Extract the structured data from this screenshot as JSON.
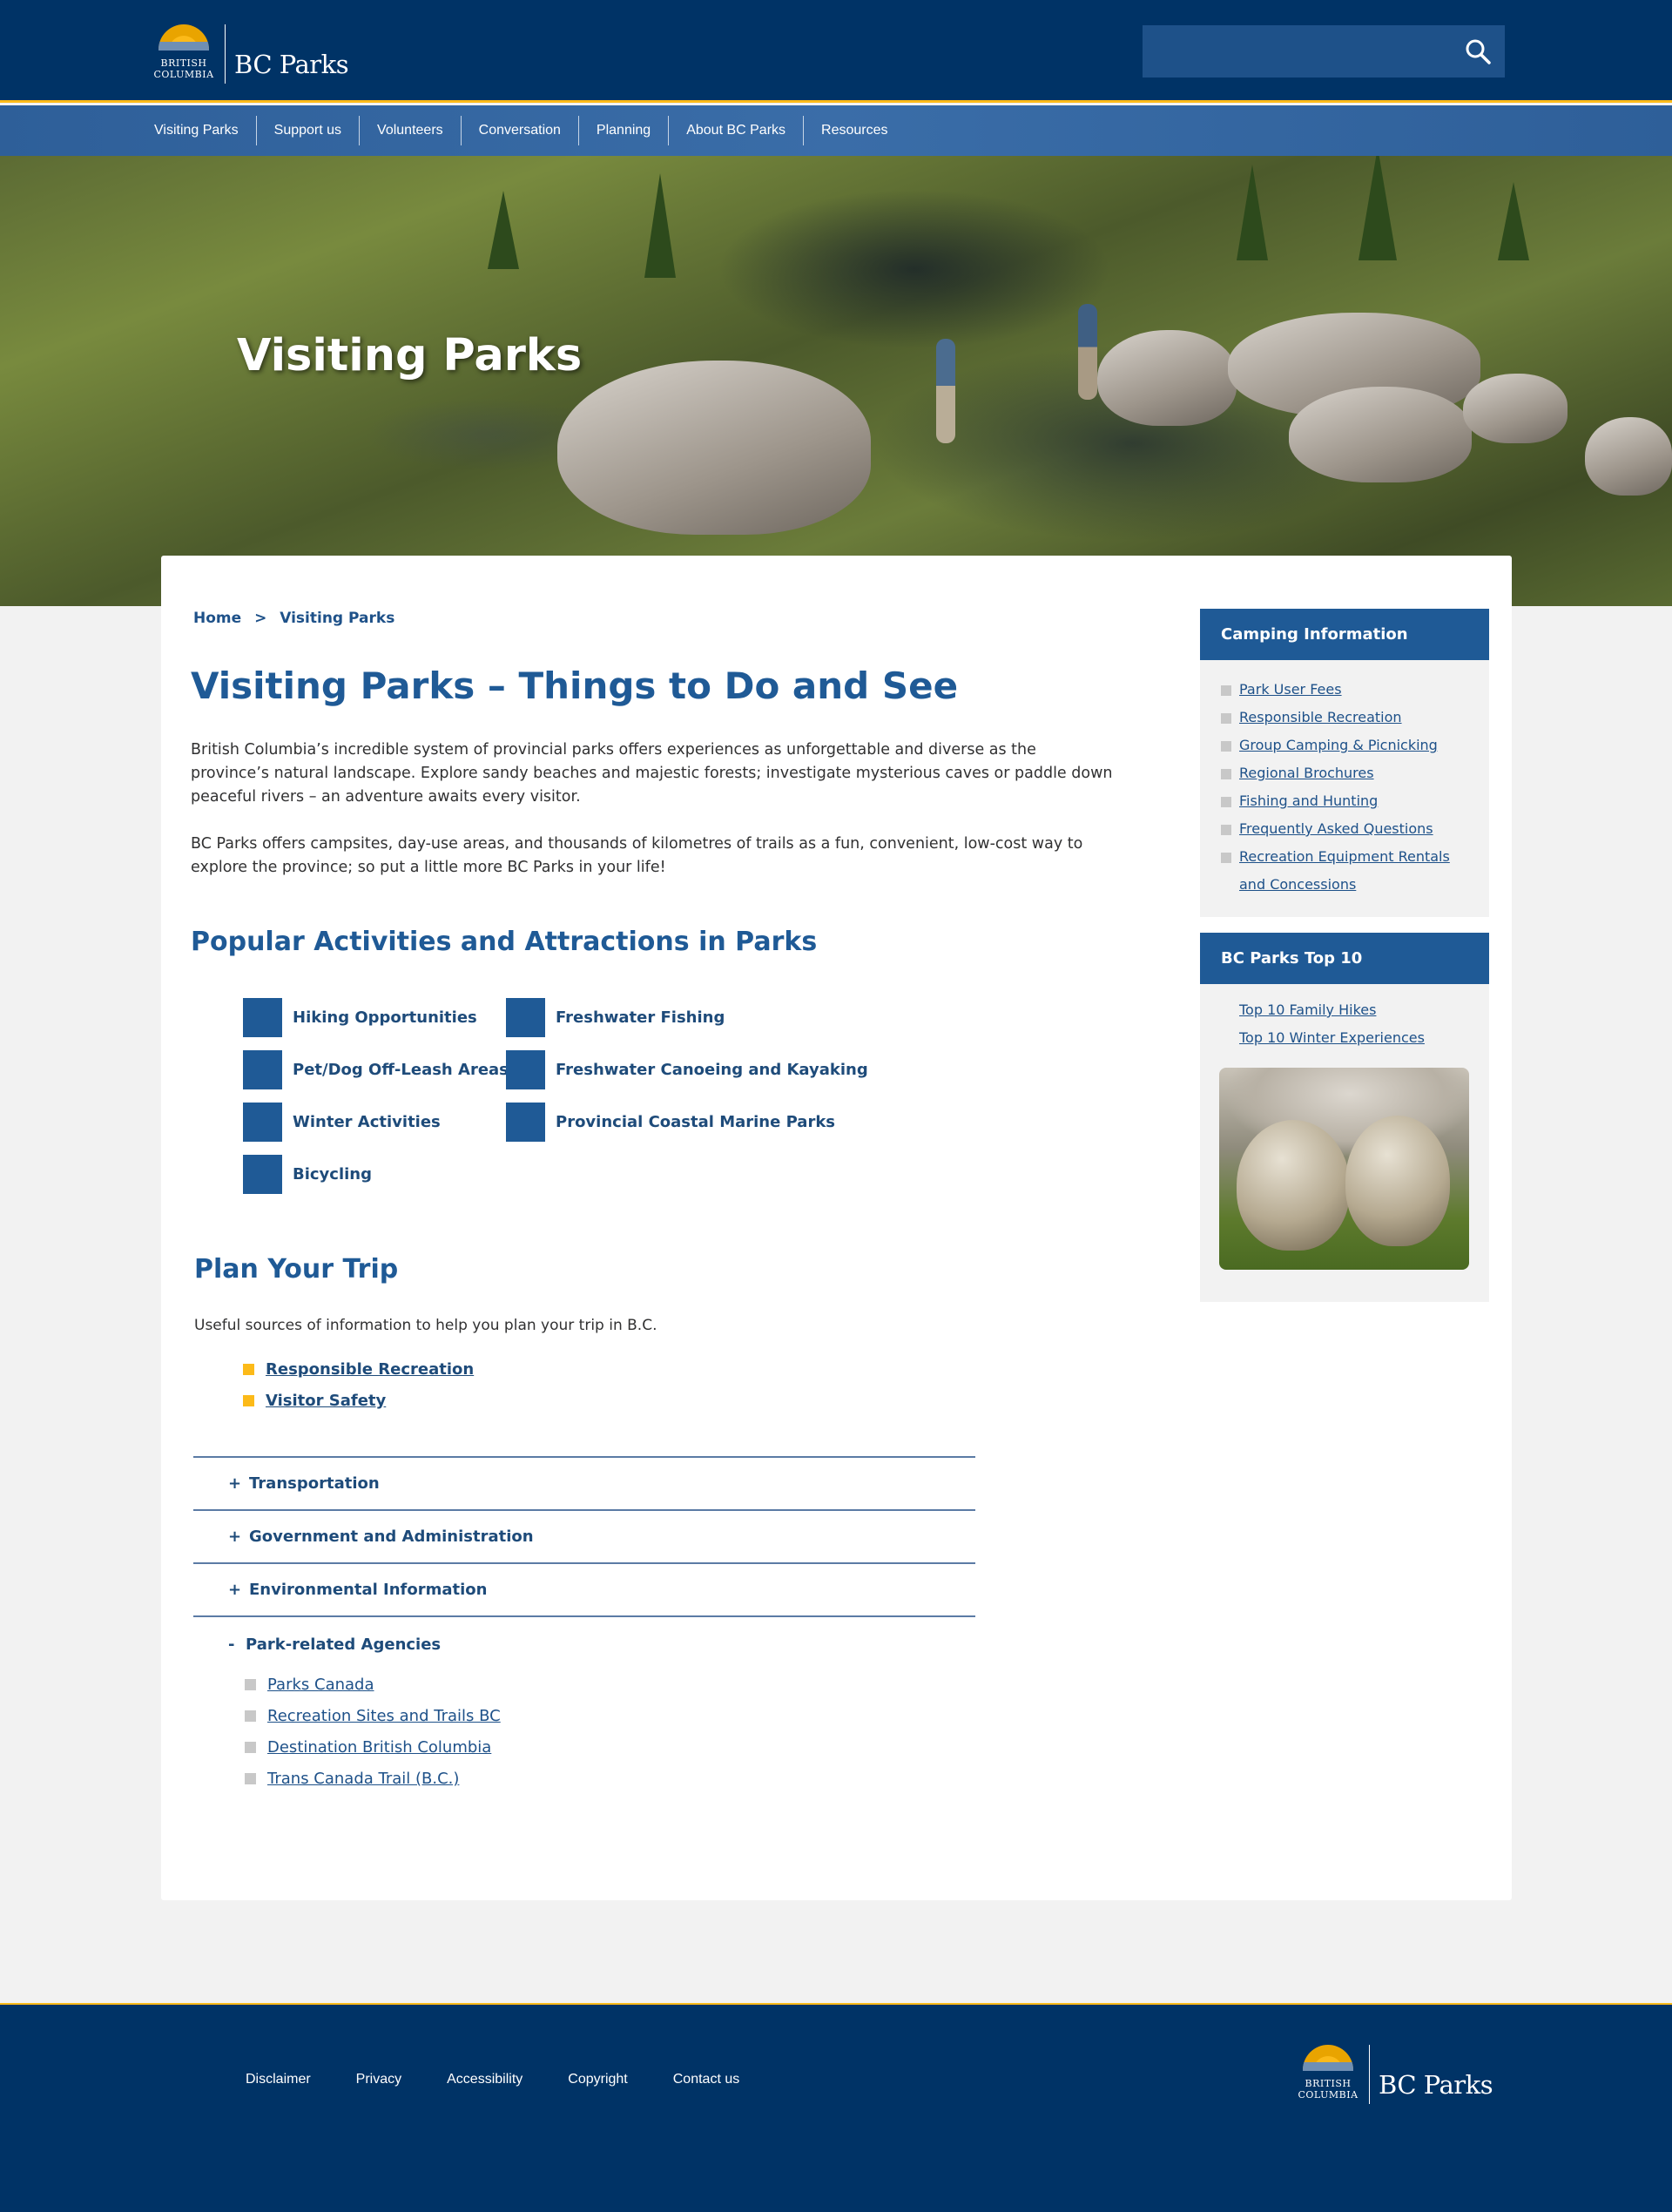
{
  "header": {
    "logo_line1": "BRITISH",
    "logo_line2": "COLUMBIA",
    "logo_name": "BC Parks",
    "search_placeholder": "",
    "search_icon": "search-icon"
  },
  "nav": {
    "items": [
      "Visiting Parks",
      "Support us",
      "Volunteers",
      "Conversation",
      "Planning",
      "About BC Parks",
      "Resources"
    ]
  },
  "hero": {
    "title": "Visiting Parks"
  },
  "breadcrumb": {
    "home": "Home",
    "separator": ">",
    "current": "Visiting Parks"
  },
  "main": {
    "title": "Visiting Parks – Things to Do and See",
    "paragraphs": [
      "British Columbia’s incredible system of provincial parks offers experiences as unforgettable and diverse as the province’s natural landscape. Explore sandy beaches and majestic forests; investigate mysterious caves or paddle down peaceful rivers – an adventure awaits every visitor.",
      "BC Parks offers campsites, day-use areas, and thousands of kilometres of trails as a fun, convenient, low-cost way to explore the province; so put a little more BC Parks in your life!"
    ],
    "activities_heading": "Popular Activities and Attractions in Parks",
    "activities": [
      "Hiking Opportunities",
      "Pet/Dog Off-Leash Areas",
      "Winter Activities",
      "Bicycling",
      "Freshwater Fishing",
      "Freshwater Canoeing and Kayaking",
      "Provincial Coastal Marine Parks"
    ],
    "plan_heading": "Plan Your Trip",
    "plan_subtext": "Useful sources of information to help you plan your trip in B.C.",
    "plan_links": [
      "Responsible Recreation",
      "Visitor Safety"
    ],
    "accordion": [
      {
        "symbol": "+",
        "label": "Transportation"
      },
      {
        "symbol": "+",
        "label": "Government and Administration"
      },
      {
        "symbol": "+",
        "label": "Environmental Information"
      },
      {
        "symbol": "-",
        "label": "Park-related Agencies"
      }
    ],
    "agencies": [
      "Parks Canada",
      "Recreation Sites and Trails BC",
      "Destination British Columbia",
      "Trans Canada Trail (B.C.)"
    ]
  },
  "sidebar": {
    "camping_heading": "Camping Information",
    "camping_links": [
      "Park User Fees",
      "Responsible Recreation",
      "Group Camping & Picnicking",
      "Regional Brochures",
      "Fishing and Hunting",
      "Frequently Asked Questions",
      "Recreation Equipment Rentals",
      "and Concessions"
    ],
    "top10_heading": "BC Parks Top 10",
    "top10_links": [
      "Top 10 Family Hikes",
      "Top 10 Winter Experiences"
    ]
  },
  "footer": {
    "links": [
      "Disclaimer",
      "Privacy",
      "Accessibility",
      "Copyright",
      "Contact us"
    ],
    "logo_line1": "BRITISH",
    "logo_line2": "COLUMBIA",
    "logo_name": "BC Parks"
  },
  "colors": {
    "header_bg": "#003366",
    "accent_gold": "#fcba19",
    "heading_blue": "#1f5a96",
    "link_blue": "#1e5189"
  }
}
